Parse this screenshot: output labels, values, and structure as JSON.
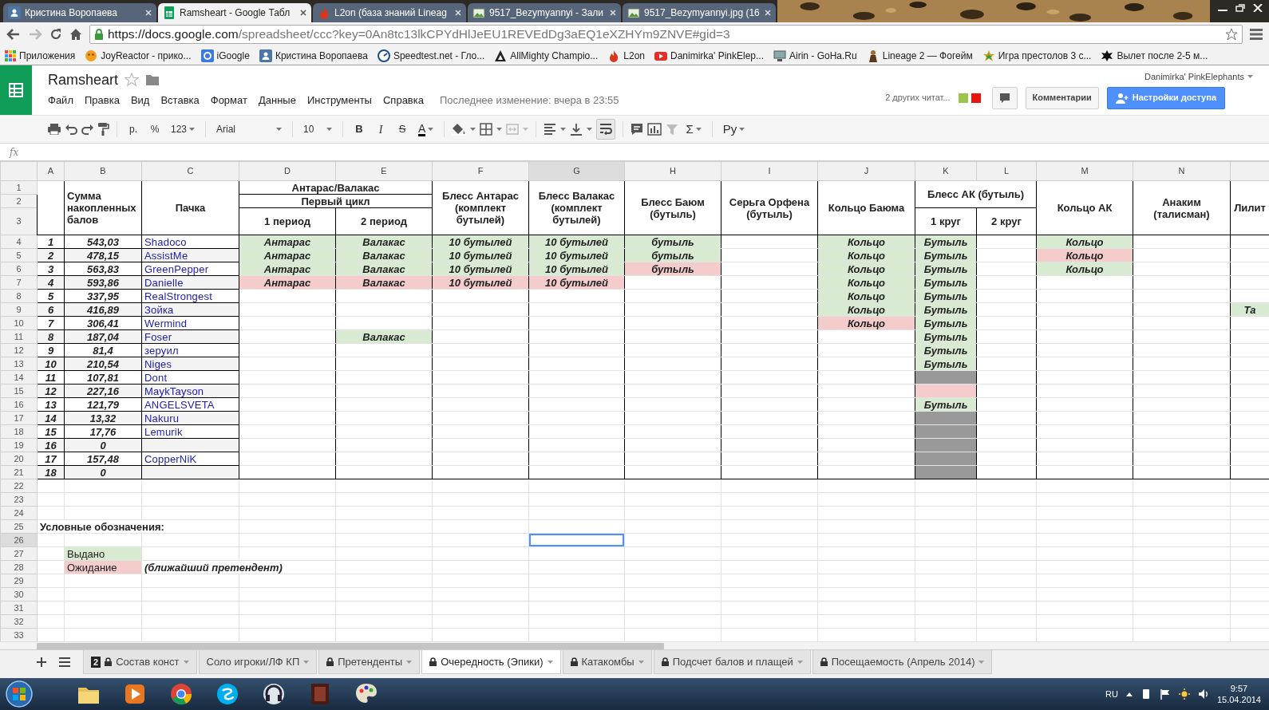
{
  "browser": {
    "tabs": [
      {
        "title": "Кристина Воропаева",
        "selected": false
      },
      {
        "title": "Ramsheart - Google Табл",
        "selected": true
      },
      {
        "title": "L2on (база знаний Lineag",
        "selected": false
      },
      {
        "title": "9517_Bezymyannyi - Зали",
        "selected": false
      },
      {
        "title": "9517_Bezymyannyi.jpg (16",
        "selected": false
      }
    ],
    "url": {
      "host": "https://docs.google.com",
      "path": "/spreadsheet/ccc?key=0An8tc13lkCPYdHlJeEU1REVEdDg3aEQ1eXZHYm9ZNVE#gid=3"
    },
    "bookmarks": [
      "Приложения",
      "JoyReactor - прико...",
      "iGoogle",
      "Кристина Воропаева",
      "Speedtest.net - Гло...",
      "AllMighty Champio...",
      "L2on",
      "Danimirka' PinkElep...",
      "Airin - GoHa.Ru",
      "Lineage 2 — Фогейм",
      "Игра престолов 3 с...",
      "Вылет после 2-5 м..."
    ]
  },
  "doc": {
    "title": "Ramsheart",
    "menu": [
      "Файл",
      "Правка",
      "Вид",
      "Вставка",
      "Формат",
      "Данные",
      "Инструменты",
      "Справка"
    ],
    "last_edit": "Последнее изменение: вчера в 23:55",
    "user": "Danimirka' PinkElephants",
    "viewers": {
      "label": "2 других читат...",
      "colors": [
        {
          "color": "#9bc64b"
        },
        {
          "color": "#e8150f"
        }
      ]
    },
    "comments_button": "Комментарии",
    "share_button": "Настройки доступа"
  },
  "toolbar": {
    "currency": "р.",
    "percent": "%",
    "number_format": "123",
    "font": "Arial",
    "font_size": "10",
    "bold": "B",
    "italic": "I",
    "strikethrough": "S",
    "text_color": "A",
    "functions": "Σ",
    "input_tools": "Ру"
  },
  "formula_bar": {
    "label": "fx"
  },
  "columns": [
    {
      "letter": "A",
      "selected": false
    },
    {
      "letter": "B",
      "selected": false
    },
    {
      "letter": "C",
      "selected": false
    },
    {
      "letter": "D",
      "selected": false
    },
    {
      "letter": "E",
      "selected": false
    },
    {
      "letter": "F",
      "selected": false
    },
    {
      "letter": "G",
      "selected": true
    },
    {
      "letter": "H",
      "selected": false
    },
    {
      "letter": "I",
      "selected": false
    },
    {
      "letter": "J",
      "selected": false
    },
    {
      "letter": "K",
      "selected": false
    },
    {
      "letter": "L",
      "selected": false
    },
    {
      "letter": "M",
      "selected": false
    },
    {
      "letter": "N",
      "selected": false
    },
    {
      "selected": false
    }
  ],
  "row_labels": [
    {
      "label": "1",
      "selected": false
    },
    {
      "label": "2",
      "selected": false
    },
    {
      "label": "3",
      "selected": false
    },
    {
      "label": "4",
      "selected": false
    },
    {
      "label": "5",
      "selected": false
    },
    {
      "label": "6",
      "selected": false
    },
    {
      "label": "7",
      "selected": false
    },
    {
      "label": "8",
      "selected": false
    },
    {
      "label": "9",
      "selected": false
    },
    {
      "label": "10",
      "selected": false
    },
    {
      "label": "11",
      "selected": false
    },
    {
      "label": "12",
      "selected": false
    },
    {
      "label": "13",
      "selected": false
    },
    {
      "label": "14",
      "selected": false
    },
    {
      "label": "15",
      "selected": false
    },
    {
      "label": "16",
      "selected": false
    },
    {
      "label": "17",
      "selected": false
    },
    {
      "label": "18",
      "selected": false
    },
    {
      "label": "19",
      "selected": false
    },
    {
      "label": "20",
      "selected": false
    },
    {
      "label": "21",
      "selected": false
    },
    {
      "label": "22",
      "selected": false
    },
    {
      "label": "23",
      "selected": false
    },
    {
      "label": "24",
      "selected": false
    },
    {
      "label": "25",
      "selected": false
    },
    {
      "label": "26",
      "selected": true
    },
    {
      "label": "27",
      "selected": false
    },
    {
      "label": "28",
      "selected": false
    },
    {
      "label": "29",
      "selected": false
    },
    {
      "label": "30",
      "selected": false
    },
    {
      "label": "31",
      "selected": false
    },
    {
      "label": "32",
      "selected": false
    },
    {
      "label": "33",
      "selected": false
    }
  ],
  "header": {
    "sum": "Сумма накопленных балов",
    "pack": "Пачка",
    "group": {
      "title": "Антарас/Валакас",
      "cycle": "Первый цикл",
      "periods": [
        "1 период",
        "2 период"
      ]
    },
    "bless_antharas": "Блесс Антарас (комплект бутылей)",
    "bless_valakas": "Блесс Валакас (комплект бутылей)",
    "bless_baium": "Блесс Баюм (бутыль)",
    "earring_orfen": "Серьга Орфена (бутыль)",
    "ring_baium": "Кольцо Баюма",
    "bless_ak": {
      "title": "Блесс АК (бутыль)",
      "rounds": [
        "1 круг",
        "2 круг"
      ]
    },
    "ring_ak": "Кольцо АК",
    "anakim": "Анаким (талисман)",
    "lilith": "Лилит"
  },
  "players": [
    {
      "num": "1",
      "sum": "543,03",
      "name": "Shadoco",
      "cells": [
        {
          "text": "Антарас",
          "color": "#d9ead3"
        },
        {
          "text": "Валакас",
          "color": "#d9ead3"
        },
        {
          "text": "10 бутылей",
          "color": "#d9ead3"
        },
        {
          "text": "10 бутылей",
          "color": "#d9ead3"
        },
        {
          "text": "бутыль",
          "color": "#d9ead3"
        },
        null,
        {
          "text": "Кольцо",
          "color": "#d9ead3"
        },
        {
          "text": "Бутыль",
          "color": "#d9ead3"
        },
        null,
        {
          "text": "Кольцо",
          "color": "#d9ead3"
        },
        null,
        null
      ]
    },
    {
      "num": "2",
      "sum": "478,15",
      "name": "AssistMe",
      "cells": [
        {
          "text": "Антарас",
          "color": "#d9ead3"
        },
        {
          "text": "Валакас",
          "color": "#d9ead3"
        },
        {
          "text": "10 бутылей",
          "color": "#d9ead3"
        },
        {
          "text": "10 бутылей",
          "color": "#d9ead3"
        },
        {
          "text": "бутыль",
          "color": "#d9ead3"
        },
        null,
        {
          "text": "Кольцо",
          "color": "#d9ead3"
        },
        {
          "text": "Бутыль",
          "color": "#d9ead3"
        },
        null,
        {
          "text": "Кольцо",
          "color": "#f4cccc"
        },
        null,
        null
      ]
    },
    {
      "num": "3",
      "sum": "563,83",
      "name": "GreenPepper",
      "cells": [
        {
          "text": "Антарас",
          "color": "#d9ead3"
        },
        {
          "text": "Валакас",
          "color": "#d9ead3"
        },
        {
          "text": "10 бутылей",
          "color": "#d9ead3"
        },
        {
          "text": "10 бутылей",
          "color": "#d9ead3"
        },
        {
          "text": "бутыль",
          "color": "#f4cccc"
        },
        null,
        {
          "text": "Кольцо",
          "color": "#d9ead3"
        },
        {
          "text": "Бутыль",
          "color": "#d9ead3"
        },
        null,
        {
          "text": "Кольцо",
          "color": "#d9ead3"
        },
        null,
        null
      ]
    },
    {
      "num": "4",
      "sum": "593,86",
      "name": "Danielle",
      "cells": [
        {
          "text": "Антарас",
          "color": "#f4cccc"
        },
        {
          "text": "Валакас",
          "color": "#f4cccc"
        },
        {
          "text": "10 бутылей",
          "color": "#f4cccc"
        },
        {
          "text": "10 бутылей",
          "color": "#f4cccc"
        },
        null,
        null,
        {
          "text": "Кольцо",
          "color": "#d9ead3"
        },
        {
          "text": "Бутыль",
          "color": "#d9ead3"
        },
        null,
        null,
        null,
        null
      ]
    },
    {
      "num": "5",
      "sum": "337,95",
      "name": "RealStrongest",
      "cells": [
        null,
        null,
        null,
        null,
        null,
        null,
        {
          "text": "Кольцо",
          "color": "#d9ead3"
        },
        {
          "text": "Бутыль",
          "color": "#d9ead3"
        },
        null,
        null,
        null,
        null
      ]
    },
    {
      "num": "6",
      "sum": "416,89",
      "name": "Зойка",
      "cells": [
        null,
        null,
        null,
        null,
        null,
        null,
        {
          "text": "Кольцо",
          "color": "#d9ead3"
        },
        {
          "text": "Бутыль",
          "color": "#d9ead3"
        },
        null,
        null,
        null,
        {
          "text": "Та",
          "color": "#d9ead3"
        }
      ]
    },
    {
      "num": "7",
      "sum": "306,41",
      "name": "Wermind",
      "cells": [
        null,
        null,
        null,
        null,
        null,
        null,
        {
          "text": "Кольцо",
          "color": "#f4cccc"
        },
        {
          "text": "Бутыль",
          "color": "#d9ead3"
        },
        null,
        null,
        null,
        null
      ]
    },
    {
      "num": "8",
      "sum": "187,04",
      "name": "Foser",
      "cells": [
        null,
        {
          "text": "Валакас",
          "color": "#d9ead3"
        },
        null,
        null,
        null,
        null,
        null,
        {
          "text": "Бутыль",
          "color": "#d9ead3"
        },
        null,
        null,
        null,
        null
      ]
    },
    {
      "num": "9",
      "sum": "81,4",
      "name": "зеруил",
      "cells": [
        null,
        null,
        null,
        null,
        null,
        null,
        null,
        {
          "text": "Бутыль",
          "color": "#d9ead3"
        },
        null,
        null,
        null,
        null
      ]
    },
    {
      "num": "10",
      "sum": "210,54",
      "name": "Niges",
      "cells": [
        null,
        null,
        null,
        null,
        null,
        null,
        null,
        {
          "text": "Бутыль",
          "color": "#d9ead3"
        },
        null,
        null,
        null,
        null
      ]
    },
    {
      "num": "11",
      "sum": "107,81",
      "name": "Dont",
      "cells": [
        null,
        null,
        null,
        null,
        null,
        null,
        null,
        {
          "color": "#999999"
        },
        null,
        null,
        null,
        null
      ]
    },
    {
      "num": "12",
      "sum": "227,16",
      "name": "MaykTayson",
      "cells": [
        null,
        null,
        null,
        null,
        null,
        null,
        null,
        {
          "color": "#f4cccc"
        },
        null,
        null,
        null,
        null
      ]
    },
    {
      "num": "13",
      "sum": "121,79",
      "name": "ANGELSVETA",
      "cells": [
        null,
        null,
        null,
        null,
        null,
        null,
        null,
        {
          "text": "Бутыль",
          "color": "#d9ead3"
        },
        null,
        null,
        null,
        null
      ]
    },
    {
      "num": "14",
      "sum": "13,32",
      "name": "Nakuru",
      "cells": [
        null,
        null,
        null,
        null,
        null,
        null,
        null,
        {
          "color": "#999999"
        },
        null,
        null,
        null,
        null
      ]
    },
    {
      "num": "15",
      "sum": "17,76",
      "name": "Lemurik",
      "cells": [
        null,
        null,
        null,
        null,
        null,
        null,
        null,
        {
          "color": "#999999"
        },
        null,
        null,
        null,
        null
      ]
    },
    {
      "num": "16",
      "sum": "0",
      "cells": [
        null,
        null,
        null,
        null,
        null,
        null,
        null,
        {
          "color": "#999999"
        },
        null,
        null,
        null,
        null
      ]
    },
    {
      "num": "17",
      "sum": "157,48",
      "name": "CopperNiK",
      "cells": [
        null,
        null,
        null,
        null,
        null,
        null,
        null,
        {
          "color": "#999999"
        },
        null,
        null,
        null,
        null
      ]
    },
    {
      "num": "18",
      "sum": "0",
      "cells": [
        null,
        null,
        null,
        null,
        null,
        null,
        null,
        {
          "color": "#999999"
        },
        null,
        null,
        null,
        null
      ]
    }
  ],
  "legend": {
    "title": "Условные обозначения:",
    "items": [
      {
        "label": "Выдано",
        "color": "#d9ead3"
      },
      {
        "label": "Ожидание",
        "color": "#f4cccc",
        "note": "(ближайший претендент)"
      }
    ]
  },
  "sheet_tabs": [
    {
      "label": "Состав конст",
      "badge": "2",
      "locked": true,
      "selected": false
    },
    {
      "label": "Соло игроки/ЛФ КП",
      "locked": false,
      "selected": false
    },
    {
      "label": "Претенденты",
      "locked": true,
      "selected": false
    },
    {
      "label": "Очередность (Эпики)",
      "locked": true,
      "selected": true
    },
    {
      "label": "Катакомбы",
      "locked": true,
      "selected": false
    },
    {
      "label": "Подсчет балов и плащей",
      "locked": true,
      "selected": false
    },
    {
      "label": "Посещаемость (Апрель 2014)",
      "locked": true,
      "selected": false
    }
  ],
  "taskbar": {
    "language": "RU",
    "time": "9:57",
    "date": "15.04.2014"
  }
}
